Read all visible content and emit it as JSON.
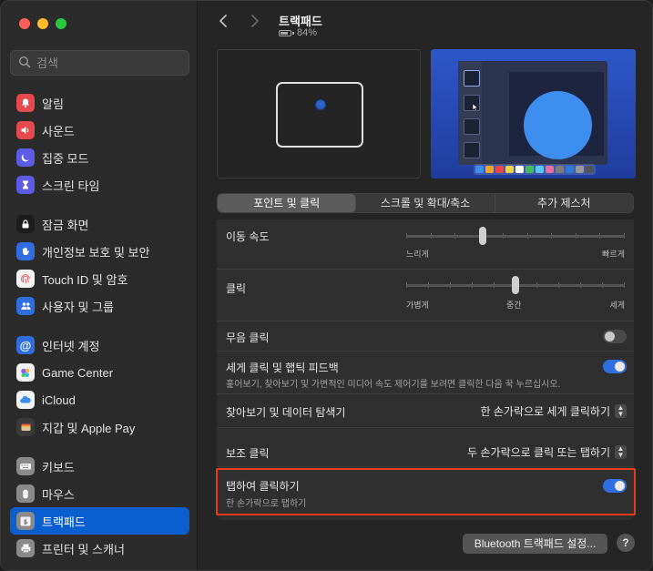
{
  "window": {
    "traffic_lights": [
      "close",
      "minimize",
      "zoom"
    ]
  },
  "search": {
    "placeholder": "검색"
  },
  "sidebar": {
    "items": [
      {
        "label": "알림",
        "icon": "bell-icon",
        "color": "#e5484d"
      },
      {
        "label": "사운드",
        "icon": "speaker-icon",
        "color": "#e5484d"
      },
      {
        "label": "집중 모드",
        "icon": "moon-icon",
        "color": "#5e5ce6"
      },
      {
        "label": "스크린 타임",
        "icon": "hourglass-icon",
        "color": "#5e5ce6"
      },
      {
        "label": "잠금 화면",
        "icon": "lock-icon",
        "color": "#1c1c1c"
      },
      {
        "label": "개인정보 보호 및 보안",
        "icon": "hand-icon",
        "color": "#2f6de0"
      },
      {
        "label": "Touch ID 및 암호",
        "icon": "fingerprint-icon",
        "color": "#f2f2f2"
      },
      {
        "label": "사용자 및 그룹",
        "icon": "users-icon",
        "color": "#2f6de0"
      },
      {
        "label": "인터넷 계정",
        "icon": "at-icon",
        "color": "#2f6de0"
      },
      {
        "label": "Game Center",
        "icon": "game-center-icon",
        "color": "#f2f2f2"
      },
      {
        "label": "iCloud",
        "icon": "cloud-icon",
        "color": "#f2f2f2"
      },
      {
        "label": "지갑 및 Apple Pay",
        "icon": "wallet-icon",
        "color": "#3a3a3a"
      },
      {
        "label": "키보드",
        "icon": "keyboard-icon",
        "color": "#8a8a8a"
      },
      {
        "label": "마우스",
        "icon": "mouse-icon",
        "color": "#8a8a8a"
      },
      {
        "label": "트랙패드",
        "icon": "trackpad-icon",
        "color": "#8a8a8a",
        "active": true
      },
      {
        "label": "프린터 및 스캐너",
        "icon": "printer-icon",
        "color": "#8a8a8a"
      }
    ]
  },
  "header": {
    "title": "트랙패드",
    "battery": "84%",
    "battery_level": 0.84
  },
  "tabs": [
    {
      "label": "포인트 및 클릭",
      "active": true
    },
    {
      "label": "스크롤 및 확대/축소",
      "active": false
    },
    {
      "label": "추가 제스처",
      "active": false
    }
  ],
  "settings": {
    "tracking_speed": {
      "label": "이동 속도",
      "min_label": "느리게",
      "max_label": "빠르게",
      "value": 0.35
    },
    "click": {
      "label": "클릭",
      "min_label": "가볍게",
      "mid_label": "중간",
      "max_label": "세게",
      "value": 0.5
    },
    "silent_click": {
      "label": "무음 클릭",
      "enabled": false
    },
    "force_click": {
      "label": "세게 클릭 및 햅틱 피드백",
      "description": "훑어보기, 찾아보기 및 가변적인 미디어 속도 제어기를 보려면 클릭한 다음 꾹 누르십시오.",
      "enabled": true
    },
    "lookup": {
      "label": "찾아보기 및 데이터 탐색기",
      "value": "한 손가락으로 세게 클릭하기"
    },
    "secondary_click": {
      "label": "보조 클릭",
      "value": "두 손가락으로 클릭 또는 탭하기"
    },
    "tap_to_click": {
      "label": "탭하여 클릭하기",
      "description": "한 손가락으로 탭하기",
      "enabled": true
    }
  },
  "footer": {
    "bluetooth_button": "Bluetooth 트랙패드 설정...",
    "help_button": "?"
  },
  "colors": {
    "accent": "#0a5fd0",
    "highlight_border": "#e83a1e"
  }
}
